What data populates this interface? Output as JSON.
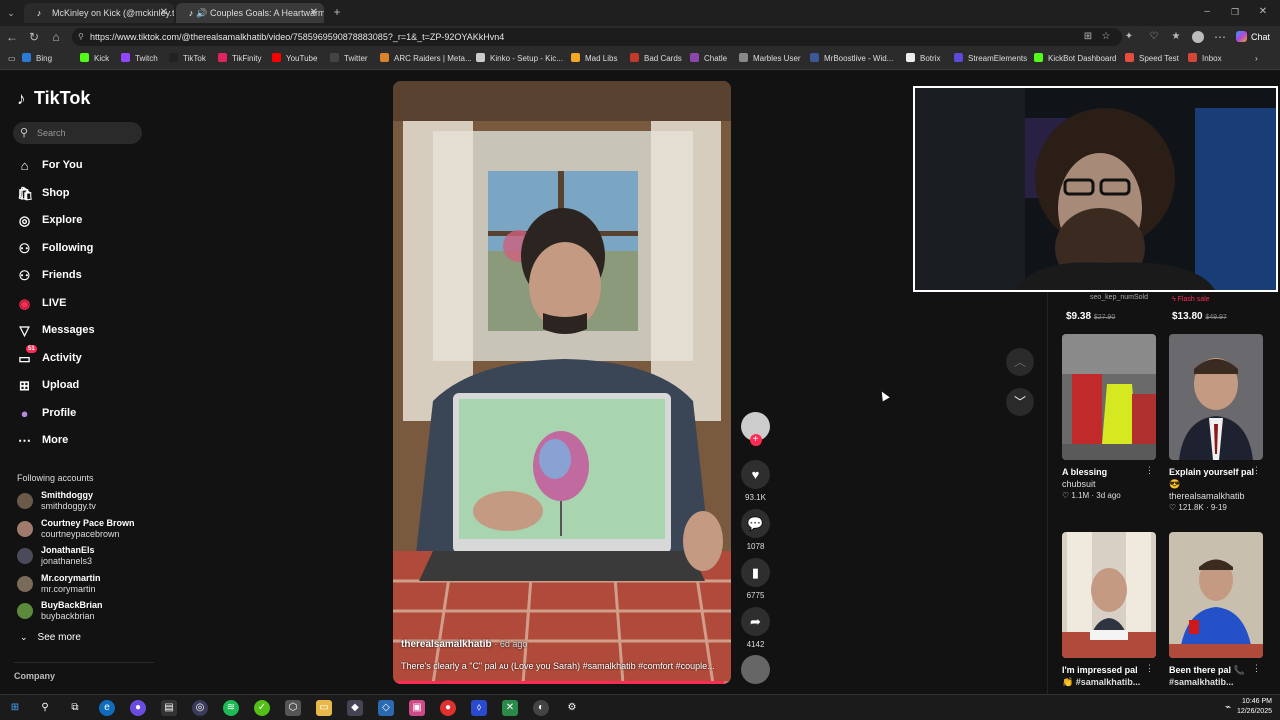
{
  "browser": {
    "tabs": [
      {
        "title": "McKinley on Kick (@mckinley.tv) |",
        "icon": "tiktok-icon"
      },
      {
        "title": "Couples Goals: A Heartwarmin",
        "icon": "tiktok-icon"
      }
    ],
    "url": "https://www.tiktok.com/@therealsamalkhatib/video/7585969590878883085?_r=1&_t=ZP-92OYAKkHvn4",
    "chat_label": "Chat",
    "bookmarks": [
      {
        "label": "Bing",
        "color": "#2b7bd6"
      },
      {
        "label": "Kick",
        "color": "#53fc18"
      },
      {
        "label": "Twitch",
        "color": "#9146ff"
      },
      {
        "label": "TikTok",
        "color": "#222222"
      },
      {
        "label": "TikFinity",
        "color": "#e0245e"
      },
      {
        "label": "YouTube",
        "color": "#ff0000"
      },
      {
        "label": "Twitter",
        "color": "#444444"
      },
      {
        "label": "ARC Raiders | Meta...",
        "color": "#d9822b"
      },
      {
        "label": "Kinko - Setup - Kic...",
        "color": "#cccccc"
      },
      {
        "label": "Mad Libs",
        "color": "#f5a623"
      },
      {
        "label": "Bad Cards",
        "color": "#c0392b"
      },
      {
        "label": "Chatle",
        "color": "#8e44ad"
      },
      {
        "label": "Marbles User",
        "color": "#888888"
      },
      {
        "label": "MrBoostlive - Wid...",
        "color": "#3b5998"
      },
      {
        "label": "Botrix",
        "color": "#eeeeee"
      },
      {
        "label": "StreamElements",
        "color": "#5b4bd6"
      },
      {
        "label": "KickBot Dashboard",
        "color": "#53fc18"
      },
      {
        "label": "Speed Test",
        "color": "#e74c3c"
      },
      {
        "label": "Inbox",
        "color": "#d44638"
      }
    ]
  },
  "sidebar": {
    "logo": "TikTok",
    "search_placeholder": "Search",
    "nav": [
      {
        "label": "For You",
        "icon": "home-icon"
      },
      {
        "label": "Shop",
        "icon": "shop-icon"
      },
      {
        "label": "Explore",
        "icon": "compass-icon"
      },
      {
        "label": "Following",
        "icon": "following-icon"
      },
      {
        "label": "Friends",
        "icon": "friends-icon"
      },
      {
        "label": "LIVE",
        "icon": "live-icon"
      },
      {
        "label": "Messages",
        "icon": "messages-icon"
      },
      {
        "label": "Activity",
        "icon": "activity-icon",
        "badge": "51"
      },
      {
        "label": "Upload",
        "icon": "upload-icon"
      },
      {
        "label": "Profile",
        "icon": "profile-icon"
      },
      {
        "label": "More",
        "icon": "more-icon"
      }
    ],
    "following_title": "Following accounts",
    "accounts": [
      {
        "name": "Smithdoggy",
        "handle": "smithdoggy.tv"
      },
      {
        "name": "Courtney Pace Brown",
        "handle": "courtneypacebrown"
      },
      {
        "name": "JonathanEls",
        "handle": "jonathanels3"
      },
      {
        "name": "Mr.corymartin",
        "handle": "mr.corymartin"
      },
      {
        "name": "BuyBackBrian",
        "handle": "buybackbrian"
      }
    ],
    "see_more": "See more",
    "company": "Company"
  },
  "video": {
    "author": "therealsamalkhatib",
    "age": "· 6d ago",
    "caption": "There's clearly a \"C\" pal ᴀᴜ (Love you Sarah) #samalkhatib #comfort #couple...",
    "progress": 0.98
  },
  "actions": {
    "likes": "93.1K",
    "comments": "1078",
    "saves": "6775",
    "shares": "4142"
  },
  "shop": [
    {
      "tag": "seo_kep_numSold",
      "price": "$9.38",
      "old": "$27.90"
    },
    {
      "tag": "Flash sale",
      "price": "$13.80",
      "old": "$49.97"
    }
  ],
  "cards": [
    {
      "title": "A blessing",
      "author": "chubsuit",
      "meta": "♡ 1.1M · 3d ago"
    },
    {
      "title": "Explain yourself pal 😎",
      "author": "therealsamalkhatib",
      "meta": "♡ 121.8K · 9-19"
    },
    {
      "title": "I'm impressed pal",
      "author": "👏 #samalkhatib...",
      "meta": ""
    },
    {
      "title": "Been there pal 📞",
      "author": "#samalkhatib...",
      "meta": ""
    }
  ],
  "taskbar": {
    "time": "10:46 PM",
    "date": "12/26/2025"
  }
}
